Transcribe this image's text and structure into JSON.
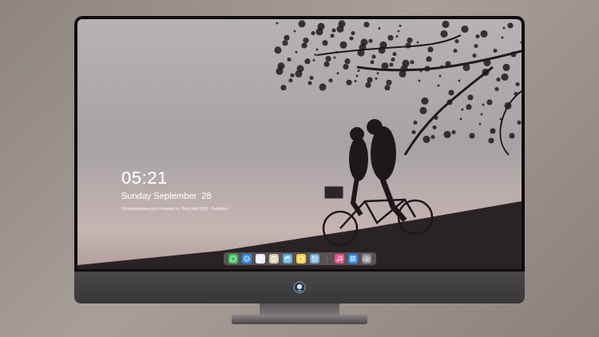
{
  "screen": {
    "clock": "05:21",
    "date": "Sunday September  28",
    "caption": "Hoatonlowayes.com Powered by: Bing daily 壁纸 · Selection"
  },
  "dock": {
    "items": [
      {
        "kind": "app",
        "color": "#3cc45a"
      },
      {
        "kind": "app",
        "color": "#2f8cf0"
      },
      {
        "kind": "app",
        "color": "#e8eef5"
      },
      {
        "kind": "app",
        "color": "#d9c9a8"
      },
      {
        "kind": "app",
        "color": "#5ab0e0"
      },
      {
        "kind": "app",
        "color": "#f5d342"
      },
      {
        "kind": "app",
        "color": "#6fb0d8"
      },
      {
        "kind": "separator",
        "color": "#6b6668"
      },
      {
        "kind": "app",
        "color": "#f2548a"
      },
      {
        "kind": "app",
        "color": "#2f8bf5"
      },
      {
        "kind": "app",
        "color": "#8e8e93"
      }
    ]
  }
}
